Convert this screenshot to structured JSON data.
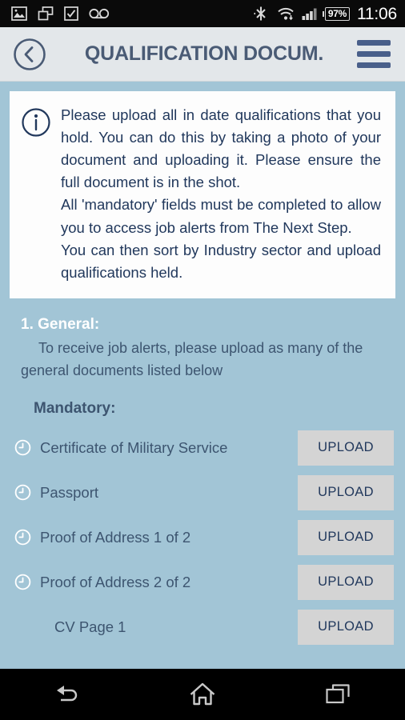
{
  "status_bar": {
    "left_icons": [
      "image-icon",
      "copy-stack-icon",
      "checkbox-icon",
      "voicemail-icon"
    ],
    "right_icons": [
      "bluetooth-off-icon",
      "wifi-icon",
      "cellular-signal-icon"
    ],
    "battery_percent": "97%",
    "time": "11:06"
  },
  "header": {
    "title": "QUALIFICATION DOCUM.",
    "back_icon": "chevron-left-circle-icon",
    "menu_icon": "hamburger-menu-icon"
  },
  "info_card": {
    "icon": "info-circle-icon",
    "paragraphs": [
      "Please upload all in date qualifications that you hold. You can do this by taking a photo of your document and uploading it. Please ensure the full document is in the shot.",
      "All 'mandatory' fields must be completed to allow you to access job alerts from The Next Step.",
      "You can then sort by Industry sector and upload qualifications held."
    ]
  },
  "section": {
    "title": "1. General:",
    "description": "To receive job alerts, please upload as many of the general documents listed below",
    "subsection_title": "Mandatory:"
  },
  "documents": [
    {
      "label": "Certificate of Military Service",
      "status_icon": "clock-pending-icon",
      "has_icon": true,
      "indent": false,
      "action": "UPLOAD"
    },
    {
      "label": "Passport",
      "status_icon": "clock-pending-icon",
      "has_icon": true,
      "indent": false,
      "action": "UPLOAD"
    },
    {
      "label": "Proof of Address 1 of 2",
      "status_icon": "clock-pending-icon",
      "has_icon": true,
      "indent": false,
      "action": "UPLOAD"
    },
    {
      "label": "Proof of Address 2 of 2",
      "status_icon": "clock-pending-icon",
      "has_icon": true,
      "indent": false,
      "action": "UPLOAD"
    },
    {
      "label": "CV Page 1",
      "status_icon": "none",
      "has_icon": false,
      "indent": true,
      "action": "UPLOAD"
    }
  ],
  "nav_bar": {
    "back_icon": "back-arrow-icon",
    "home_icon": "home-icon",
    "recents_icon": "recent-apps-icon"
  },
  "colors": {
    "page_background": "#a2c5d6",
    "header_background": "#e3e7ea",
    "header_text": "#4a5b75",
    "body_text": "#3d5570",
    "card_background": "#fdfdfd",
    "accent_navy": "#21385c",
    "menu_blue": "#495f8a",
    "upload_button": "#d4d4d4"
  }
}
